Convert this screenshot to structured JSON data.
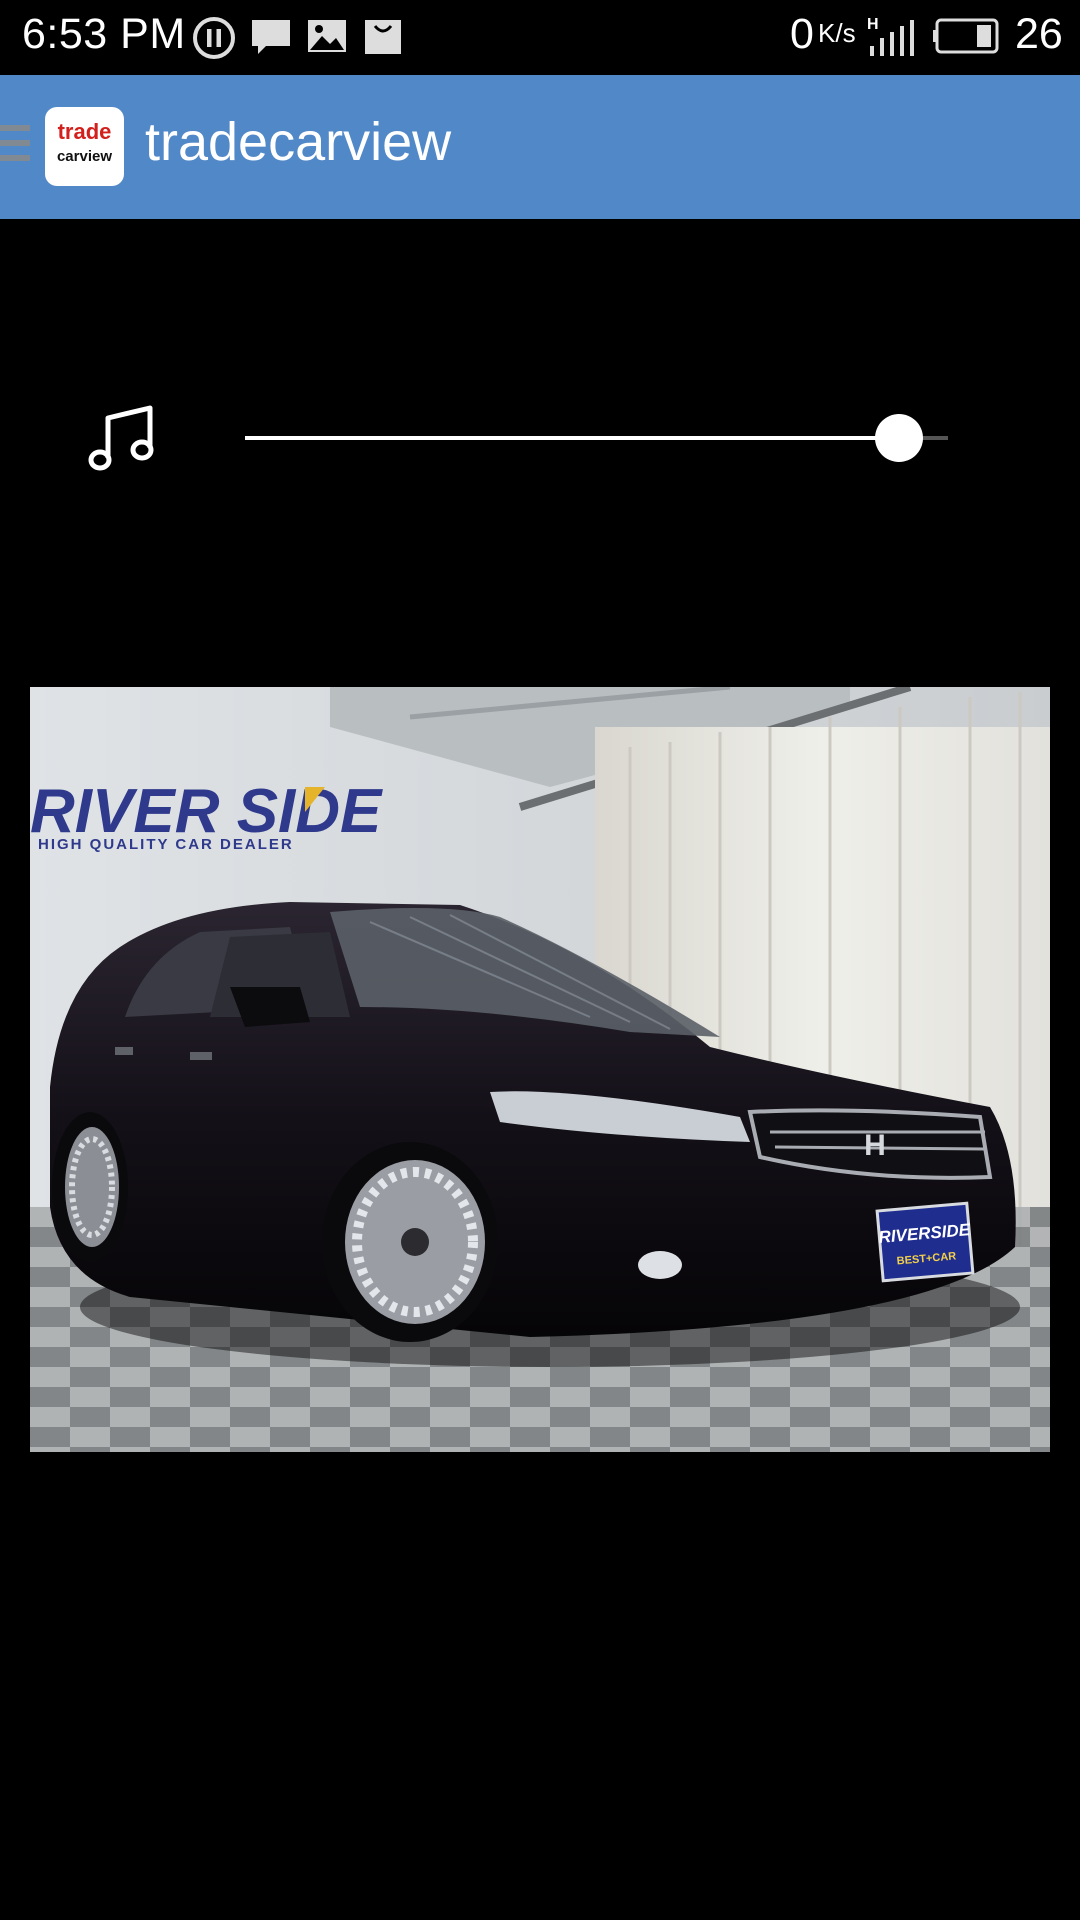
{
  "status_bar": {
    "time": "6:53 PM",
    "speed_value": "0",
    "speed_unit": "K/s",
    "battery": "26",
    "network_type": "H",
    "icons": [
      "pause-icon",
      "message-icon",
      "image-icon",
      "bag-icon",
      "signal-icon",
      "battery-icon"
    ]
  },
  "app_bar": {
    "title": "tradecarview",
    "logo_top": "trade",
    "logo_bottom": "carview"
  },
  "audio": {
    "icon": "music-note-icon",
    "progress": 0.93
  },
  "photo": {
    "sign_text": "RIVER SIDE",
    "sign_subtext": "HIGH QUALITY CAR DEALER",
    "plate_text": "RIVERSIDE",
    "plate_subtext": "BEST+CAR"
  },
  "colors": {
    "app_bar": "#5188c7",
    "background": "#000000",
    "logo_red": "#d2201d"
  }
}
